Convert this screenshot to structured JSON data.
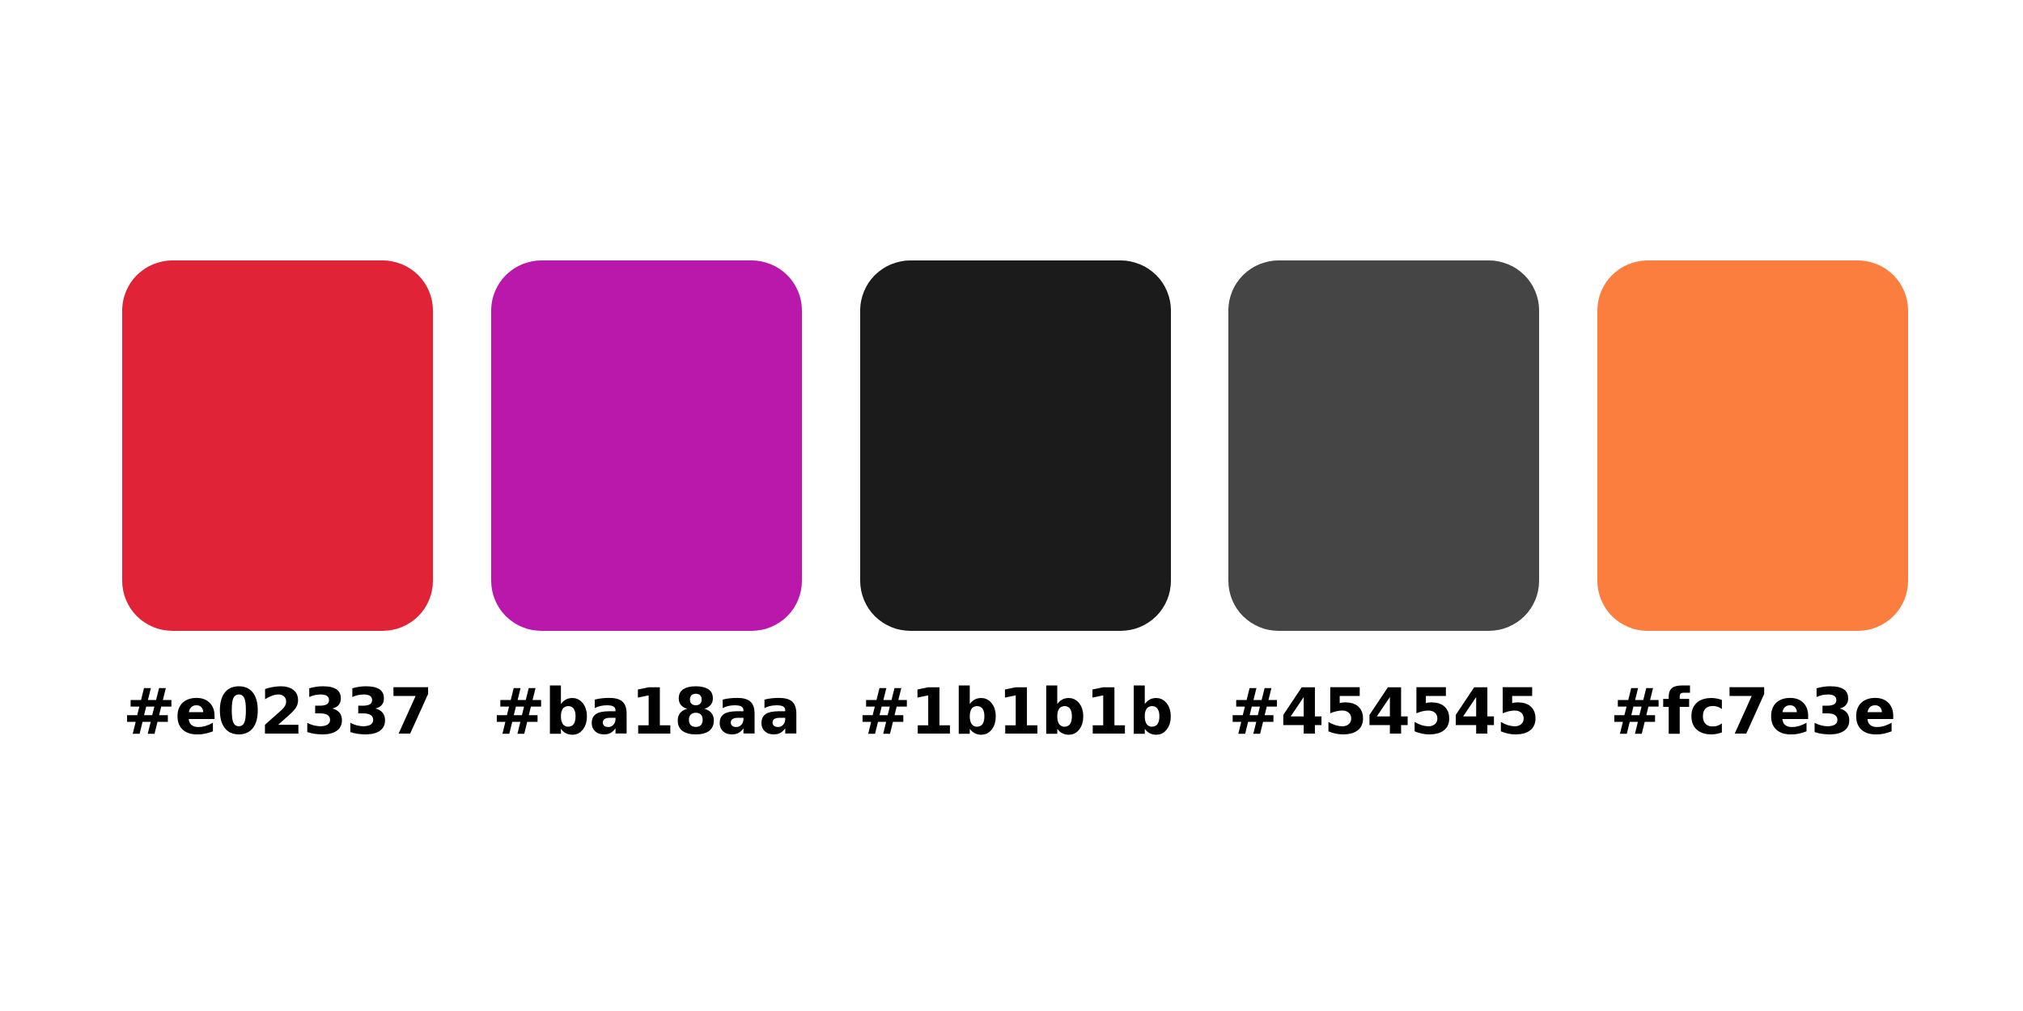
{
  "palette": {
    "swatches": [
      {
        "color": "#e02337",
        "label": "#e02337"
      },
      {
        "color": "#ba18aa",
        "label": "#ba18aa"
      },
      {
        "color": "#1b1b1b",
        "label": "#1b1b1b"
      },
      {
        "color": "#454545",
        "label": "#454545"
      },
      {
        "color": "#fc7e3e",
        "label": "#fc7e3e"
      }
    ]
  }
}
